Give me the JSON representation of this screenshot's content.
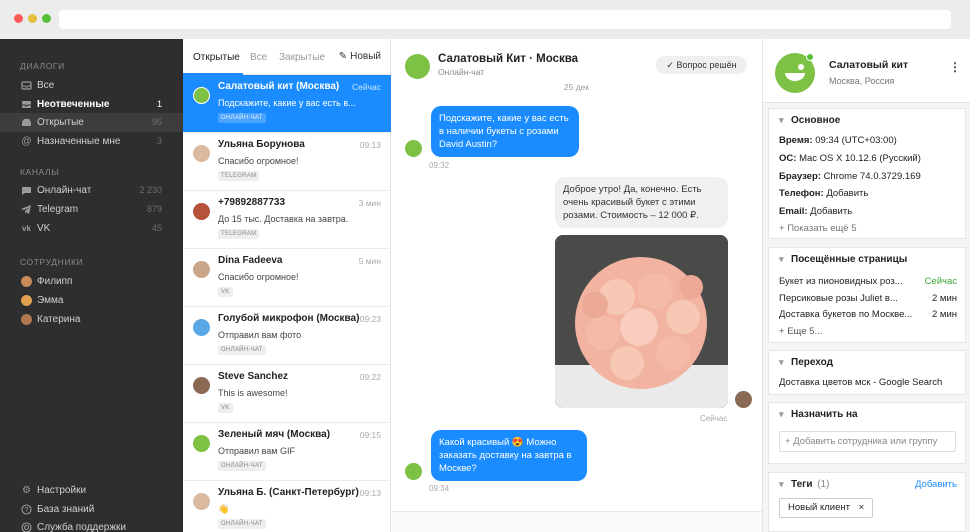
{
  "sidebar": {
    "sections": {
      "dialogs": "ДИАЛОГИ",
      "channels": "КАНАЛЫ",
      "staff": "СОТРУДНИКИ"
    },
    "dialogs": [
      {
        "label": "Все",
        "count": "",
        "icon": "inbox-icon"
      },
      {
        "label": "Неотвеченные",
        "count": "1",
        "icon": "inbox-icon"
      },
      {
        "label": "Открытые",
        "count": "95",
        "icon": "inbox-open-icon"
      },
      {
        "label": "Назначенные мне",
        "count": "3",
        "icon": "at-icon"
      }
    ],
    "channels": [
      {
        "label": "Онлайн-чат",
        "count": "2 230",
        "icon": "chat-icon"
      },
      {
        "label": "Telegram",
        "count": "879",
        "icon": "telegram-icon"
      },
      {
        "label": "VK",
        "count": "45",
        "icon": "vk-icon"
      }
    ],
    "staff": [
      {
        "label": "Филипп"
      },
      {
        "label": "Эмма"
      },
      {
        "label": "Катерина"
      }
    ],
    "bottom": [
      {
        "label": "Настройки",
        "icon": "gear-icon"
      },
      {
        "label": "База знаний",
        "icon": "help-icon"
      },
      {
        "label": "Служба поддержки",
        "icon": "support-icon"
      }
    ]
  },
  "list": {
    "tabs": [
      "Открытые",
      "Все",
      "Закрытые"
    ],
    "new_label": "Новый",
    "items": [
      {
        "name": "Салатовый кит (Москва)",
        "time": "Сейчас",
        "preview": "Подскажите, какие у вас есть в...",
        "tag": "ОНЛАЙН-ЧАТ"
      },
      {
        "name": "Ульяна Борунова",
        "time": "09:13",
        "preview": "Спасибо огромное!",
        "tag": "TELEGRAM"
      },
      {
        "name": "+79892887733",
        "time": "3 мин",
        "preview": "До 15 тыс. Доставка на завтра.",
        "tag": "TELEGRAM"
      },
      {
        "name": "Dina Fadeeva",
        "time": "5 мин",
        "preview": "Спасибо огромное!",
        "tag": "VK"
      },
      {
        "name": "Голубой микрофон (Москва)",
        "time": "09:23",
        "preview": "Отправил вам фото",
        "tag": "ОНЛАЙН-ЧАТ"
      },
      {
        "name": "Steve Sanchez",
        "time": "09:22",
        "preview": "This is awesome!",
        "tag": "VK"
      },
      {
        "name": "Зеленый мяч (Москва)",
        "time": "09:15",
        "preview": "Отправил вам GIF",
        "tag": "ОНЛАЙН-ЧАТ"
      },
      {
        "name": "Ульяна Б. (Санкт-Петербург)",
        "time": "09:13",
        "preview": "👋",
        "tag": "ОНЛАЙН-ЧАТ"
      }
    ]
  },
  "chat": {
    "title": "Салатовый Кит · Москва",
    "subtitle": "Онлайн-чат",
    "solved_label": "Вопрос решён",
    "date": "25 дек",
    "messages": [
      {
        "text": "Подскажите, какие у вас есть в наличии букеты с розами David Austin?",
        "time": "09:32"
      },
      {
        "text": "Доброе утро! Да, конечно. Есть очень красивый букет с этими розами. Стоимость – 12 000 ₽.",
        "time": ""
      },
      {
        "text": "Сейчас",
        "time": "Сейчас"
      },
      {
        "text": "Какой красивый 😍 Можно заказать доставку на завтра в Москве?",
        "time": "09:34"
      }
    ]
  },
  "info": {
    "name": "Салатовый кит",
    "location": "Москва, Россия",
    "basic": {
      "title": "Основное",
      "rows": [
        {
          "k": "Время:",
          "v": "09:34 (UTC+03:00)"
        },
        {
          "k": "ОС:",
          "v": "Mac OS X 10.12.6 (Русский)"
        },
        {
          "k": "Браузер:",
          "v": "Chrome 74.0.3729.169"
        },
        {
          "k": "Телефон:",
          "v": "Добавить"
        },
        {
          "k": "Email:",
          "v": "Добавить"
        }
      ],
      "more": "Показать ещё 5"
    },
    "pages": {
      "title": "Посещённые страницы",
      "rows": [
        {
          "page": "Букет из пионовидных роз...",
          "time": "Сейчас"
        },
        {
          "page": "Персиковые розы Juliet в...",
          "time": "2 мин"
        },
        {
          "page": "Доставка букетов по Москве...",
          "time": "2 мин"
        }
      ],
      "more": "Еще 5..."
    },
    "referral": {
      "title": "Переход",
      "value": "Доставка цветов мск - Google Search"
    },
    "assign": {
      "title": "Назначить на",
      "placeholder": "Добавить сотрудника или группу"
    },
    "tags": {
      "title": "Теги",
      "count": "(1)",
      "add": "Добавить",
      "items": [
        "Новый клиент"
      ]
    }
  },
  "colors": {
    "accent": "#1a8cff",
    "brand_green": "#7dc244",
    "sidebar": "#2e2e2e"
  }
}
